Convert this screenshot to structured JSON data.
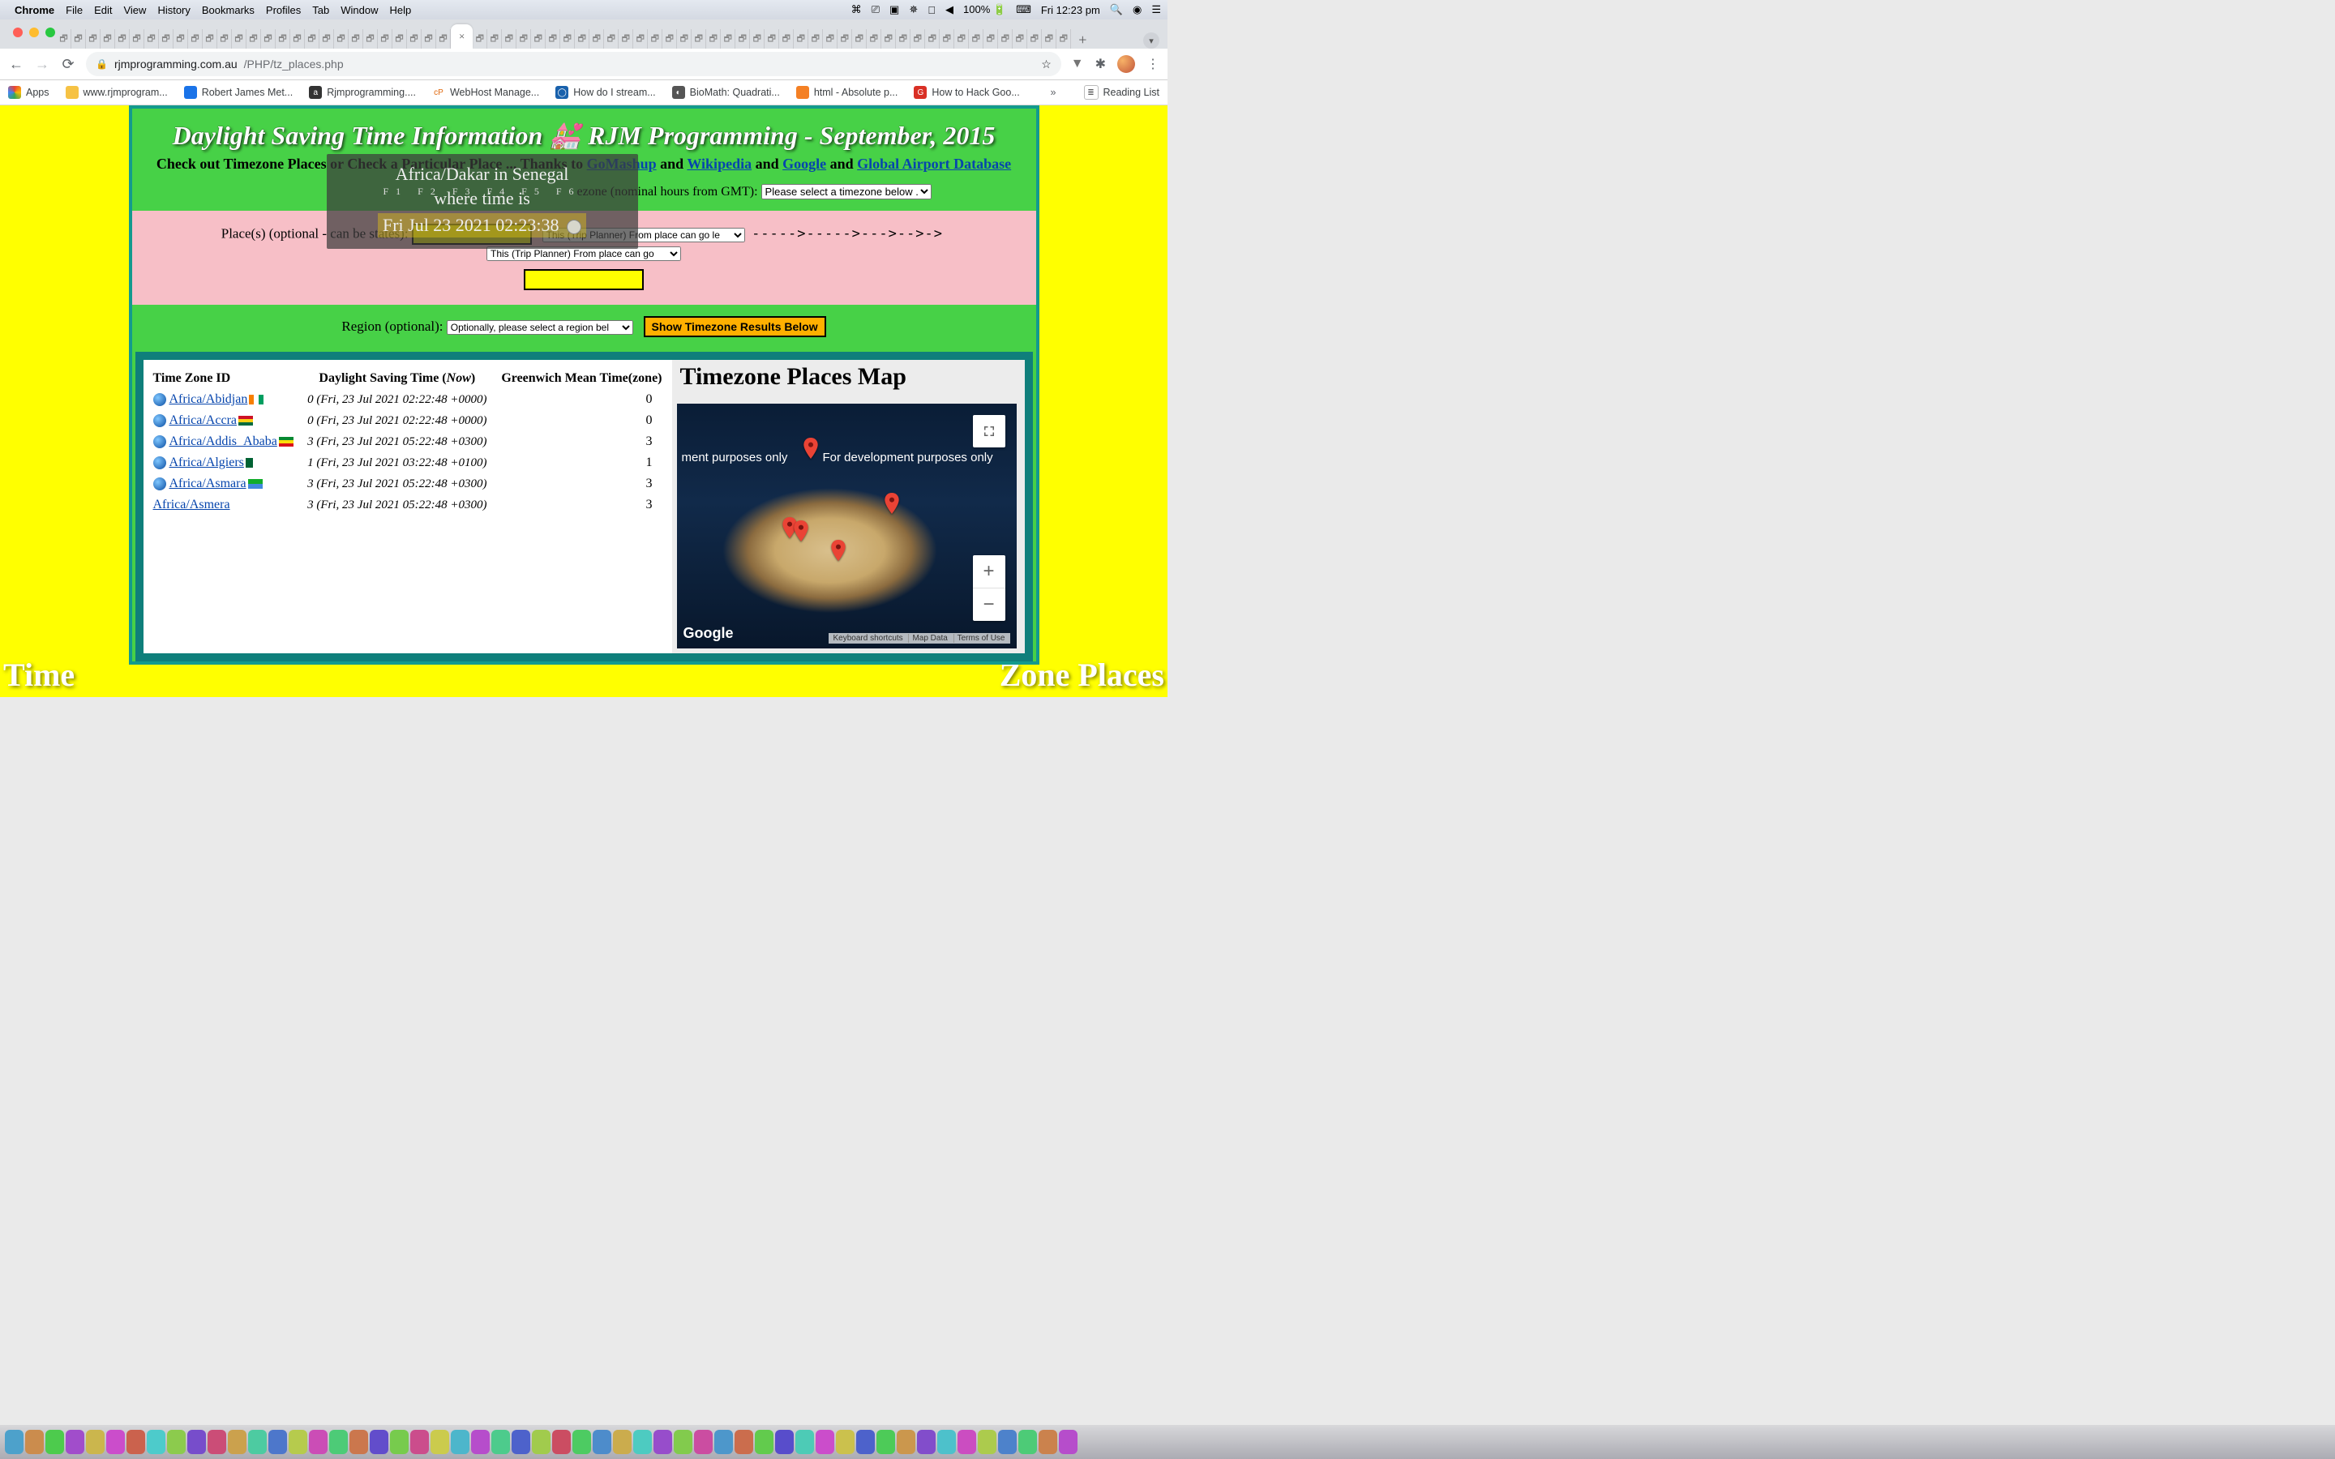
{
  "menubar": {
    "app": "Chrome",
    "items": [
      "File",
      "Edit",
      "View",
      "History",
      "Bookmarks",
      "Profiles",
      "Tab",
      "Window",
      "Help"
    ],
    "battery": "100%",
    "clock": "Fri 12:23 pm"
  },
  "chrome": {
    "active_tab_close": "×",
    "new_tab": "+",
    "url_domain": "rjmprogramming.com.au",
    "url_path": "/PHP/tz_places.php",
    "toolbar_star": "☆",
    "bookmarks": [
      {
        "label": "Apps",
        "fav_bg": "#fff",
        "fav_txt": ""
      },
      {
        "label": "www.rjmprogram...",
        "fav_bg": "#f6c244",
        "fav_txt": ""
      },
      {
        "label": "Robert James Met...",
        "fav_bg": "#1a73e8",
        "fav_txt": ""
      },
      {
        "label": "Rjmprogramming....",
        "fav_bg": "#333",
        "fav_txt": "a"
      },
      {
        "label": "WebHost Manage...",
        "fav_bg": "#fff",
        "fav_txt": "cP",
        "fav_color": "#e06a10"
      },
      {
        "label": "How do I stream...",
        "fav_bg": "#1961ac",
        "fav_txt": "◯"
      },
      {
        "label": "BioMath: Quadrati...",
        "fav_bg": "#555",
        "fav_txt": "◐"
      },
      {
        "label": "html - Absolute p...",
        "fav_bg": "#f48024",
        "fav_txt": ""
      },
      {
        "label": "How to Hack Goo...",
        "fav_bg": "#d93025",
        "fav_txt": "G"
      }
    ],
    "bookmarks_more": "»",
    "reading_list": "Reading List"
  },
  "page": {
    "title_a": "Daylight Saving Time Information",
    "title_emoji": "💒",
    "title_b": "RJM Programming - September, 2015",
    "sub_prefix": "Check out Timezone Places or Check a Particular Place ... Thanks to ",
    "sub_links": [
      "GoMashup",
      "Wikipedia",
      "Google",
      "Global Airport Database"
    ],
    "sub_and": " and ",
    "overlay_place": "Africa/Dakar in Senegal",
    "overlay_where": "where time is",
    "overlay_time": "Fri Jul 23 2021 02:23:38",
    "overlay_fkeys": "F1 F2 F3 F4 F5 F6",
    "tzselect_label_tail": "ezone (nominal hours from GMT): ",
    "tzselect_value": "Please select a timezone below ..",
    "places_label": "Place(s) (optional - can be states): ",
    "from_select": "This (Trip Planner) From place can go le",
    "arrows": "----->----->--->-->->",
    "to_select": "This (Trip Planner) From place can go",
    "region_label": "Region (optional): ",
    "region_select": "Optionally, please select a region bel",
    "go_button": "Show Timezone Results Below",
    "gutter_left": "Time",
    "gutter_right": "Zone Places"
  },
  "table": {
    "h1": "Time Zone ID",
    "h2a": "Daylight Saving Time (",
    "h2b": "Now",
    "h2c": ")",
    "h3": "Greenwich Mean Time(zone)",
    "rows": [
      {
        "id": "Africa/Abidjan",
        "flag": "ci",
        "dst": "0 (Fri, 23 Jul 2021 02:22:48 +0000)",
        "gmt": "0",
        "globe": true
      },
      {
        "id": "Africa/Accra",
        "flag": "gh",
        "dst": "0 (Fri, 23 Jul 2021 02:22:48 +0000)",
        "gmt": "0",
        "globe": true
      },
      {
        "id": "Africa/Addis_Ababa",
        "flag": "et",
        "dst": "3 (Fri, 23 Jul 2021 05:22:48 +0300)",
        "gmt": "3",
        "globe": true
      },
      {
        "id": "Africa/Algiers",
        "flag": "dz",
        "dst": "1 (Fri, 23 Jul 2021 03:22:48 +0100)",
        "gmt": "1",
        "globe": true
      },
      {
        "id": "Africa/Asmara",
        "flag": "er",
        "dst": "3 (Fri, 23 Jul 2021 05:22:48 +0300)",
        "gmt": "3",
        "globe": true
      },
      {
        "id": "Africa/Asmera",
        "flag": "",
        "dst": "3 (Fri, 23 Jul 2021 05:22:48 +0300)",
        "gmt": "3",
        "globe": false
      }
    ]
  },
  "map": {
    "title": "Timezone Places Map",
    "devtext_left": "ment purposes only",
    "devtext_right": "For development purposes only",
    "google": "Google",
    "legal": [
      "Keyboard shortcuts",
      "Map Data",
      "Terms of Use"
    ]
  }
}
